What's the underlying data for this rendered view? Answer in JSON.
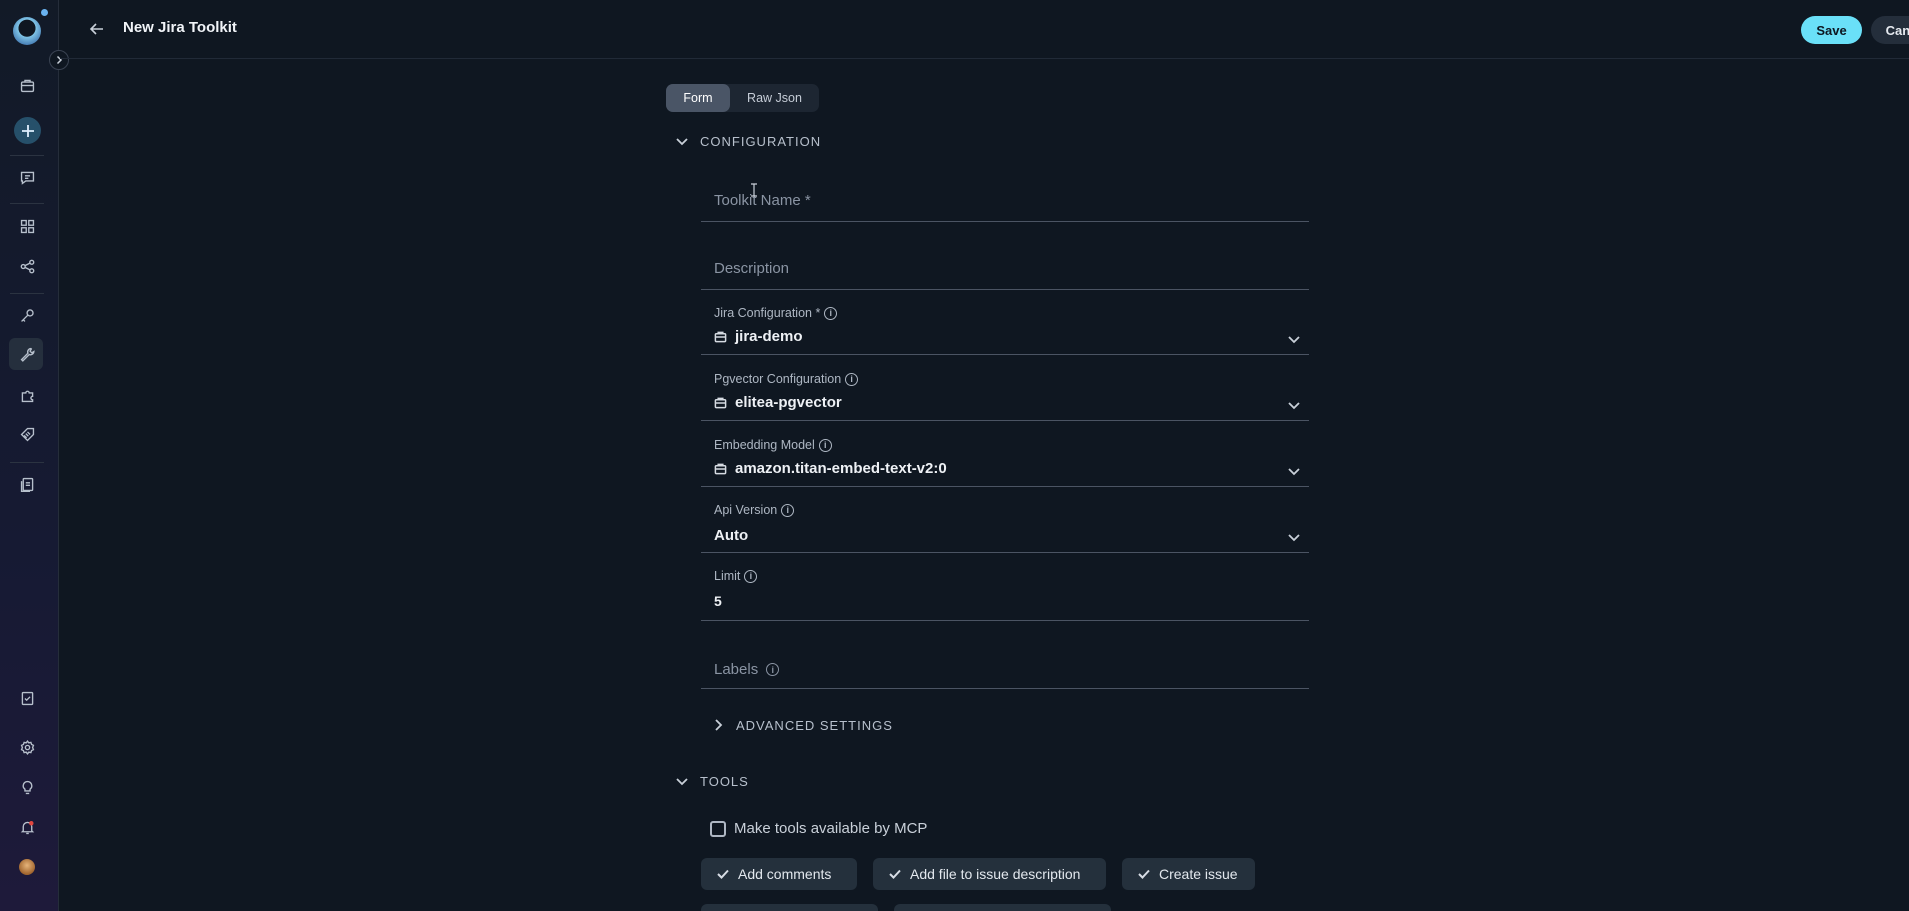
{
  "header": {
    "title": "New Jira Toolkit",
    "save_label": "Save",
    "cancel_label": "Cancel"
  },
  "tabs": [
    {
      "label": "Form",
      "active": true
    },
    {
      "label": "Raw Json",
      "active": false
    }
  ],
  "configuration": {
    "section_label": "CONFIGURATION",
    "toolkit_name_placeholder": "Toolkit Name *",
    "description_placeholder": "Description",
    "jira_configuration": {
      "label": "Jira Configuration *",
      "value": "jira-demo"
    },
    "pgvector_configuration": {
      "label": "Pgvector Configuration",
      "value": "elitea-pgvector"
    },
    "embedding_model": {
      "label": "Embedding Model",
      "value": "amazon.titan-embed-text-v2:0"
    },
    "api_version": {
      "label": "Api Version",
      "value": "Auto"
    },
    "limit": {
      "label": "Limit",
      "value": "5"
    },
    "labels_placeholder": "Labels",
    "advanced_settings_label": "ADVANCED SETTINGS"
  },
  "tools": {
    "section_label": "TOOLS",
    "mcp_checkbox_label": "Make tools available by MCP",
    "mcp_checked": false,
    "chips": [
      "Add comments",
      "Add file to issue description",
      "Create issue"
    ]
  },
  "sidebar": {
    "icons": [
      "toolbox-icon",
      "add-icon",
      "chat-icon",
      "grid-icon",
      "pipeline-icon",
      "key-icon",
      "wrench-icon",
      "puzzle-icon",
      "tag-icon",
      "documents-icon",
      "notes-icon",
      "settings-icon",
      "lightbulb-icon",
      "notification-icon",
      "avatar"
    ]
  },
  "colors": {
    "accent": "#6ae0f8",
    "background": "#0f1721"
  }
}
